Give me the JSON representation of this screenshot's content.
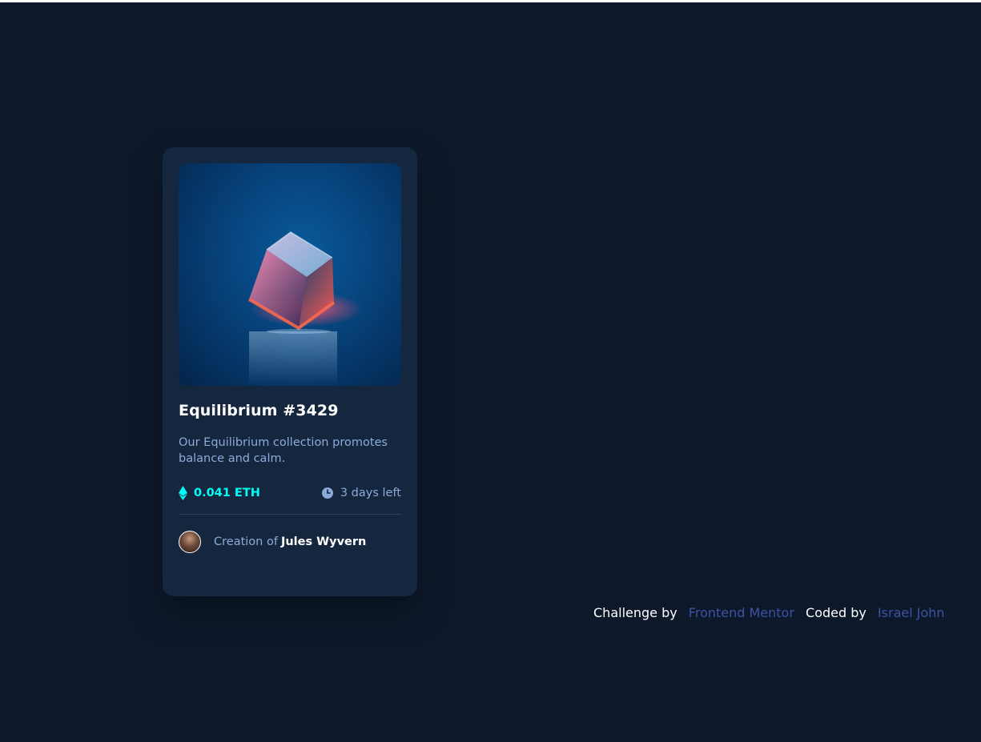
{
  "card": {
    "image_alt": "equilibrium-cube-image",
    "title": "Equilibrium #3429",
    "description": "Our Equilibrium collection promotes balance and calm.",
    "price": "0.041 ETH",
    "time_left": "3 days left",
    "creator_prefix": "Creation of",
    "creator_name": "Jules Wyvern",
    "icons": {
      "price": "ethereum-icon",
      "time": "clock-icon"
    }
  },
  "attribution": {
    "challenge_label": "Challenge by",
    "challenge_link": "Frontend Mentor",
    "coded_label": "Coded by",
    "coded_link": "Israel John"
  },
  "colors": {
    "page_bg": "#0d192b",
    "card_bg": "#15263f",
    "cyan": "#00fff8",
    "soft_blue": "#8bacd9",
    "link_blue": "#3e52a3",
    "white": "#ffffff"
  }
}
